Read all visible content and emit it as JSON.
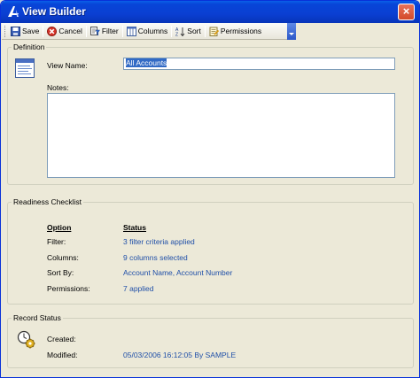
{
  "window": {
    "title": "View Builder",
    "close_glyph": "×"
  },
  "toolbar": {
    "save_label": "Save",
    "cancel_label": "Cancel",
    "filter_label": "Filter",
    "columns_label": "Columns",
    "sort_label": "Sort",
    "permissions_label": "Permissions"
  },
  "definition": {
    "group_label": "Definition",
    "view_name_label": "View Name:",
    "view_name_value": "All Accounts",
    "notes_label": "Notes:",
    "notes_value": ""
  },
  "readiness": {
    "group_label": "Readiness Checklist",
    "option_header": "Option",
    "status_header": "Status",
    "rows": [
      {
        "option": "Filter:",
        "status": "3 filter criteria applied"
      },
      {
        "option": "Columns:",
        "status": "9 columns selected"
      },
      {
        "option": "Sort By:",
        "status": "Account Name, Account Number"
      },
      {
        "option": "Permissions:",
        "status": "7 applied"
      }
    ]
  },
  "record_status": {
    "group_label": "Record Status",
    "created_label": "Created:",
    "created_value": "",
    "modified_label": "Modified:",
    "modified_value": "05/03/2006 16:12:05 By SAMPLE"
  },
  "colors": {
    "link": "#1f4fa8",
    "titlebar": "#0a3fd2",
    "panel": "#ece9d8"
  }
}
